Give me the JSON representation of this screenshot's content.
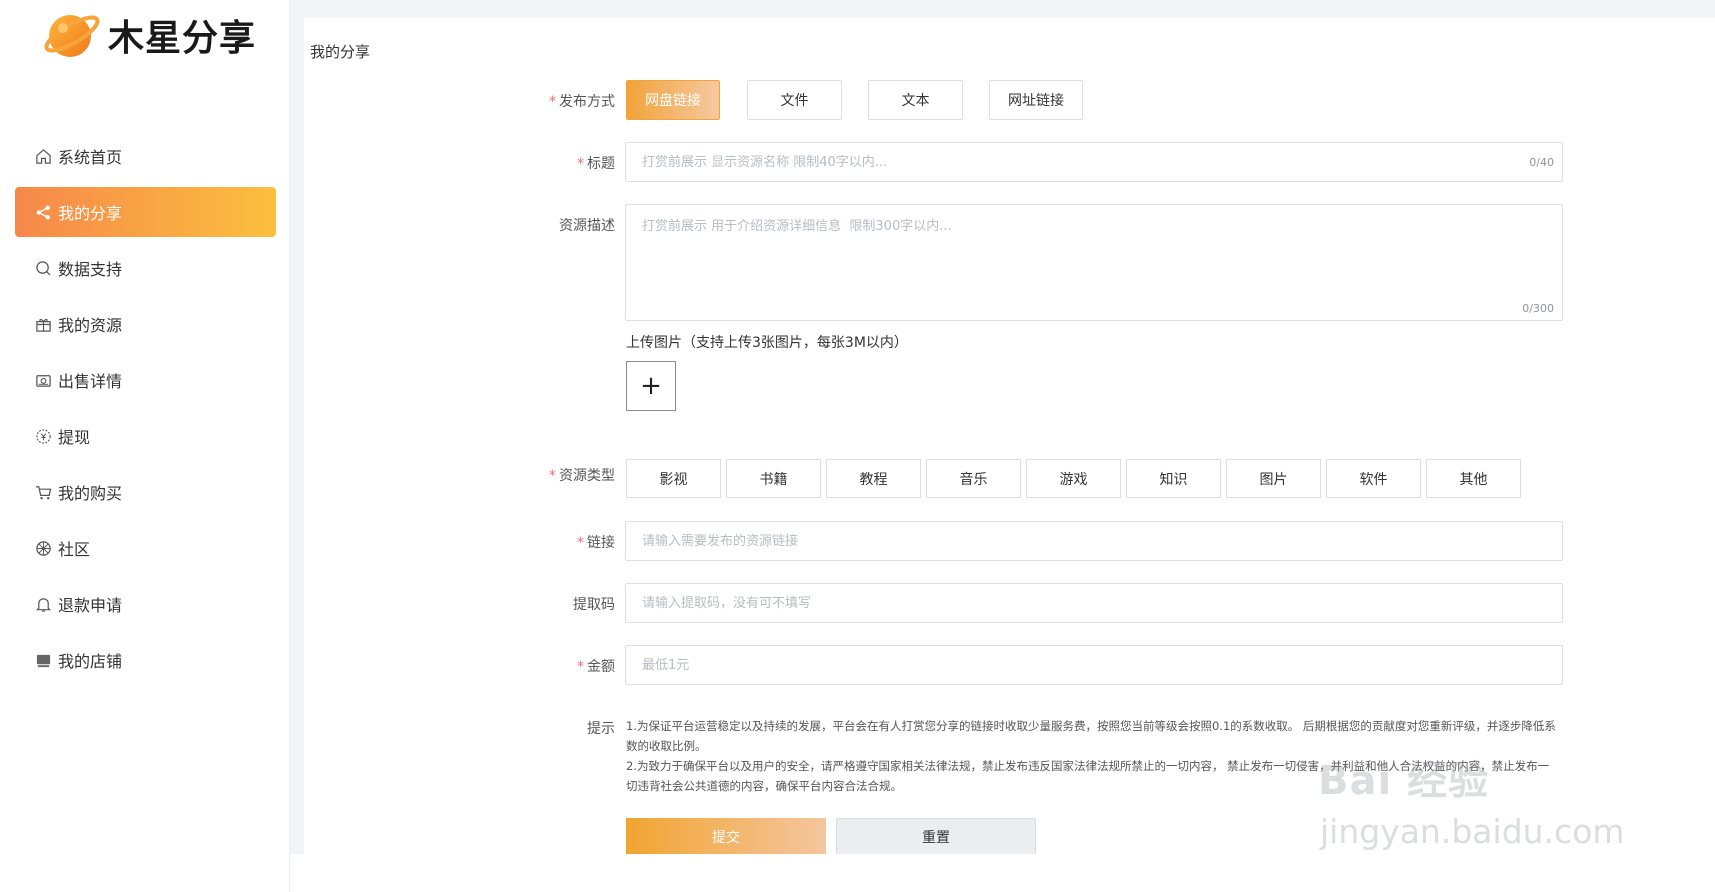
{
  "brand": {
    "name": "木星分享",
    "accent": "#f6884a",
    "accent_end": "#fbbf3e"
  },
  "sidebar": {
    "items": [
      {
        "label": "系统首页",
        "icon": "home-icon",
        "active": false
      },
      {
        "label": "我的分享",
        "icon": "share-icon",
        "active": true
      },
      {
        "label": "数据支持",
        "icon": "search-icon",
        "active": false
      },
      {
        "label": "我的资源",
        "icon": "gift-icon",
        "active": false
      },
      {
        "label": "出售详情",
        "icon": "wallet-icon",
        "active": false
      },
      {
        "label": "提现",
        "icon": "coin-icon",
        "active": false
      },
      {
        "label": "我的购买",
        "icon": "cart-icon",
        "active": false
      },
      {
        "label": "社区",
        "icon": "community-icon",
        "active": false
      },
      {
        "label": "退款申请",
        "icon": "bell-icon",
        "active": false
      },
      {
        "label": "我的店铺",
        "icon": "store-icon",
        "active": false
      }
    ]
  },
  "main": {
    "title": "我的分享",
    "form": {
      "publish_method": {
        "required_mark": "*",
        "label": "发布方式",
        "options": [
          "网盘链接",
          "文件",
          "文本",
          "网址链接"
        ],
        "selected": "网盘链接"
      },
      "title_field": {
        "required_mark": "*",
        "label": "标题",
        "placeholder": "打赏前展示 显示资源名称 限制40字以内...",
        "value": "",
        "counter": "0/40"
      },
      "description_field": {
        "label": "资源描述",
        "placeholder": "打赏前展示 用于介绍资源详细信息  限制300字以内...",
        "value": "",
        "counter": "0/300"
      },
      "upload": {
        "label": "上传图片（支持上传3张图片，每张3M以内）",
        "button_glyph": "+"
      },
      "resource_type": {
        "required_mark": "*",
        "label": "资源类型",
        "options": [
          "影视",
          "书籍",
          "教程",
          "音乐",
          "游戏",
          "知识",
          "图片",
          "软件",
          "其他"
        ]
      },
      "link_field": {
        "required_mark": "*",
        "label": "链接",
        "placeholder": "请输入需要发布的资源链接",
        "value": ""
      },
      "code_field": {
        "label": "提取码",
        "placeholder": "请输入提取码，没有可不填写",
        "value": ""
      },
      "amount_field": {
        "required_mark": "*",
        "label": "金额",
        "placeholder": "最低1元",
        "value": ""
      },
      "tips": {
        "label": "提示",
        "line1": "1.为保证平台运营稳定以及持续的发展，平台会在有人打赏您分享的链接时收取少量服务费，按照您当前等级会按照0.1的系数收取。 后期根据您的贡献度对您重新评级，并逐步降低系数的收取比例。",
        "line2": "2.为致力于确保平台以及用户的安全，请严格遵守国家相关法律法规，禁止发布违反国家法律法规所禁止的一切内容， 禁止发布一切侵害，并利益和他人合法权益的内容，禁止发布一切违背社会公共道德的内容，确保平台内容合法合规。"
      },
      "buttons": {
        "submit": "提交",
        "reset": "重置"
      }
    }
  },
  "watermark": {
    "top": "Bai 经验",
    "bottom": "jingyan.baidu.com"
  }
}
